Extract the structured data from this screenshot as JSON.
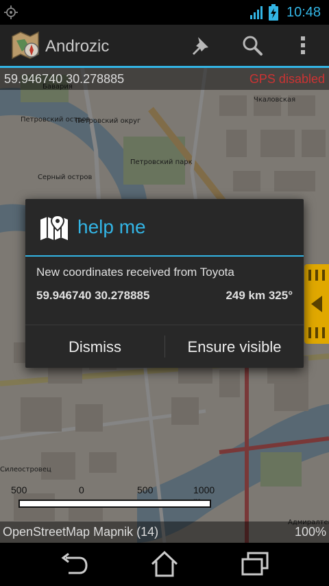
{
  "statusbar": {
    "time": "10:48"
  },
  "actionbar": {
    "title": "Androzic"
  },
  "map": {
    "coordinates": "59.946740 30.278885",
    "gps_status": "GPS disabled",
    "source": "OpenStreetMap Mapnik (14)",
    "zoom": "100%",
    "scale_labels": [
      "500",
      "0",
      "500",
      "1000 m"
    ],
    "labels": [
      "Бавария",
      "Петровский остров",
      "Петровский округ",
      "Петровский парк",
      "Чкаловская",
      "Серный остров",
      "Силеостровец",
      "Адмиралтейская"
    ]
  },
  "dialog": {
    "title": "help me",
    "message": "New coordinates received from Toyota",
    "coordinates": "59.946740 30.278885",
    "distance": "249 km 325°",
    "dismiss_label": "Dismiss",
    "ensure_label": "Ensure visible"
  },
  "colors": {
    "accent": "#33b5e5",
    "gps_disabled": "#cc3333",
    "handle": "#e0a800"
  }
}
